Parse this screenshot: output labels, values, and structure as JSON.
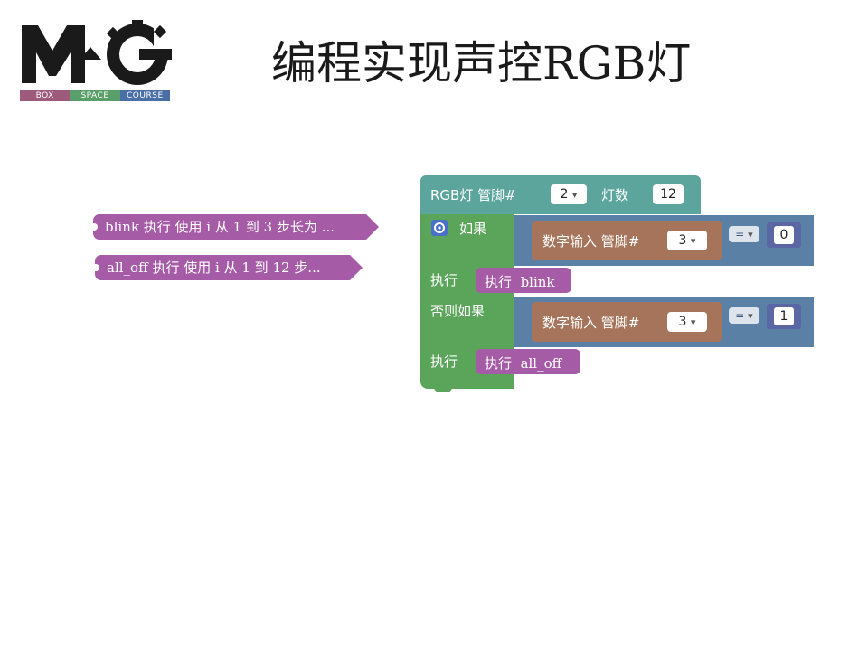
{
  "title": "编程实现声控RGB灯",
  "logo": {
    "bar": [
      "BOX",
      "SPACE",
      "COURSE"
    ],
    "colors": {
      "box": "#9e5a7a",
      "space": "#5a9e6a",
      "course": "#4a6ea6",
      "letters": "#1a1a1a"
    }
  },
  "procedures": [
    {
      "label": "blink  执行  使用 i 从 1 到 3 步长为 ..."
    },
    {
      "label": "all_off  执行  使用 i 从 1 到 12 步..."
    }
  ],
  "rgb_block": {
    "label_rgb": "RGB灯  管脚#",
    "pin_value": "2",
    "label_count": "灯数",
    "count_value": "12"
  },
  "if_block": {
    "if_label": "如果",
    "do_label_1": "执行",
    "elseif_label": "否则如果",
    "do_label_2": "执行",
    "cond1": {
      "pin_label": "数字输入 管脚#",
      "pin_value": "3",
      "op": "=",
      "compare_value": "0"
    },
    "cond2": {
      "pin_label": "数字输入 管脚#",
      "pin_value": "3",
      "op": "=",
      "compare_value": "1"
    },
    "action1": {
      "label": "执行",
      "name": "blink"
    },
    "action2": {
      "label": "执行",
      "name": "all_off"
    }
  },
  "colors": {
    "teal": "#5ba59c",
    "green": "#5ba55b",
    "blue": "#5b80a5",
    "brown": "#a5745b",
    "purple": "#a55ba6",
    "number": "#5b67a5"
  }
}
